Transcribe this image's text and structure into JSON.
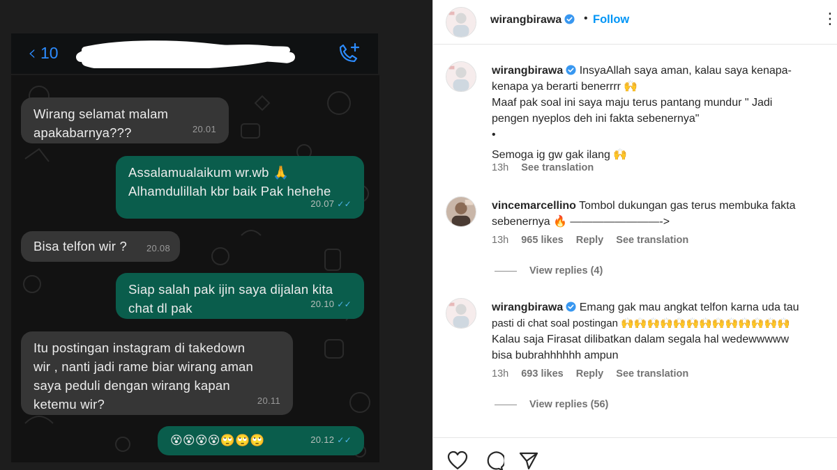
{
  "whatsapp": {
    "contact_prefix": "10",
    "messages": [
      {
        "dir": "in",
        "text": "Wirang selamat malam\napakabarnya???",
        "time": "20.01"
      },
      {
        "dir": "out",
        "text": "Assalamualaikum wr.wb 🙏\nAlhamdulillah kbr baik Pak hehehe",
        "time": "20.07"
      },
      {
        "dir": "in",
        "text": "Bisa telfon wir ?",
        "time": "20.08"
      },
      {
        "dir": "out",
        "text": "Siap salah pak ijin saya dijalan kita\nchat dl pak",
        "time": "20.10"
      },
      {
        "dir": "in",
        "text": "Itu postingan instagram di takedown\nwir , nanti jadi rame biar wirang aman\nsaya peduli dengan wirang kapan\nketemu wir?",
        "time": "20.11"
      },
      {
        "dir": "out",
        "text": "😵😵😵😵🙄🙄🙄",
        "time": "20.12"
      }
    ],
    "colors": {
      "incoming": "#363636",
      "outgoing": "#0a5d4c",
      "accent": "#2d8cff"
    }
  },
  "instagram": {
    "header": {
      "username": "wirangbirawa",
      "separator": "•",
      "follow_label": "Follow",
      "more": "⋮"
    },
    "comments": [
      {
        "username": "wirangbirawa",
        "verified": true,
        "lines": [
          "InsyaAllah saya aman, kalau saya kenapa-",
          "kenapa ya berarti benerrrr 🙌",
          "Maaf pak soal ini saya maju terus pantang mundur \" Jadi",
          "pengen nyeplos deh ini fakta sebenernya\"",
          "•",
          "Semoga ig gw gak ilang 🙌"
        ],
        "time": "13h",
        "likes": "",
        "reply": "",
        "see_translation": "See translation"
      },
      {
        "username": "vincemarcellino",
        "verified": false,
        "lines": [
          "Tombol dukungan gas terus membuka fakta",
          "sebenernya 🔥 ————————->"
        ],
        "time": "13h",
        "likes": "965 likes",
        "reply": "Reply",
        "see_translation": "See translation",
        "view_replies": "View replies (4)"
      },
      {
        "username": "wirangbirawa",
        "verified": true,
        "lines": [
          "Emang gak mau angkat telfon karna uda tau",
          "pasti di chat soal postingan 🙌🙌🙌🙌🙌🙌🙌🙌🙌🙌🙌🙌🙌",
          "Kalau saja Firasat dilibatkan dalam segala hal wedewwwww",
          "bisa bubrahhhhhh ampun"
        ],
        "time": "13h",
        "likes": "693 likes",
        "reply": "Reply",
        "see_translation": "See translation",
        "view_replies": "View replies (56)"
      }
    ],
    "colors": {
      "follow": "#0095f6",
      "muted": "#737373",
      "verified": "#3897f0"
    }
  }
}
